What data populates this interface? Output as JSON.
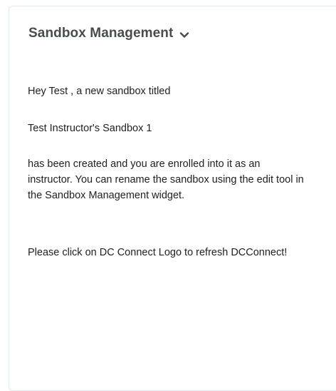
{
  "widget": {
    "title": "Sandbox Management",
    "toggle_icon": "chevron-down-icon",
    "title_color": "#494c4e",
    "border_color": "#e3e9f1"
  },
  "message": {
    "greeting": "Hey Test , a new sandbox titled",
    "sandbox_name": "Test Instructor's Sandbox 1",
    "created_notice": "has been created and you are enrolled into it as an instructor. You can rename the sandbox using the edit tool in the Sandbox Management widget.",
    "refresh_notice": "Please click on DC Connect Logo to refresh DCConnect!"
  }
}
